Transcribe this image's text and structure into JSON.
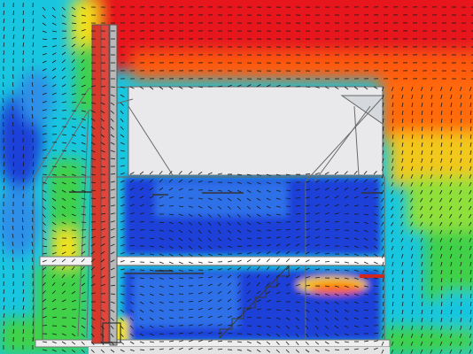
{
  "colors": {
    "hot": "#e6121a",
    "warm": "#ff7a10",
    "yellow": "#f2e21a",
    "green": "#3fd14a",
    "cyan": "#19c6df",
    "mid_blue": "#2f8fe8",
    "cold": "#1a3fd8",
    "building_fill": "#e9e9ec",
    "wall_line": "#7a7a7a",
    "chimney": "#d8392a"
  },
  "elements": [
    "heat-map-background",
    "velocity-vector-field",
    "building-section",
    "upper-room",
    "lower-room",
    "staircase",
    "chimney-flue",
    "roof-glazing"
  ]
}
